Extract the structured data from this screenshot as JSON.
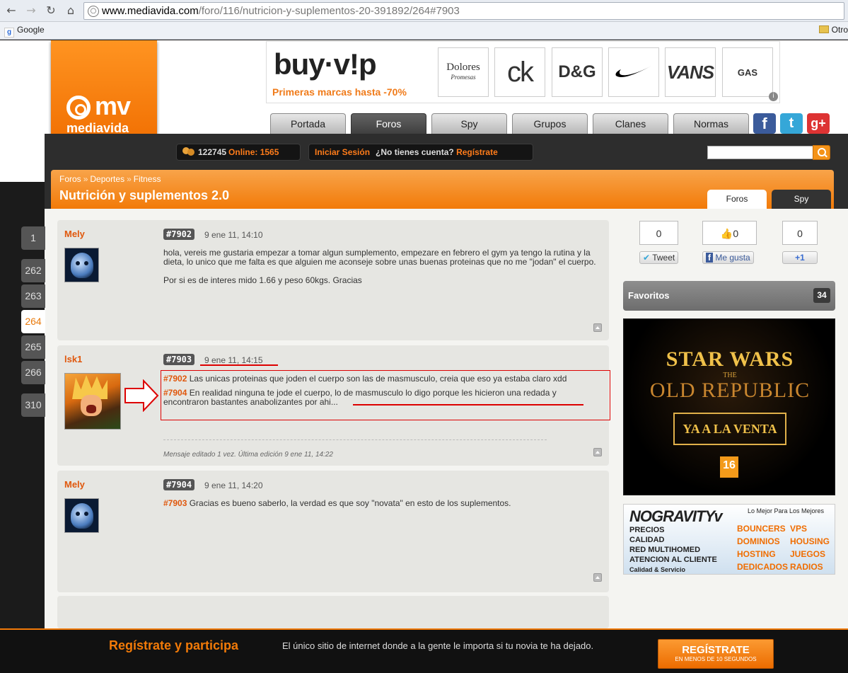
{
  "browser": {
    "url_host": "www.mediavida.com",
    "url_path": "/foro/116/nutricion-y-suplementos-20-391892/264#7903",
    "bookmarks": {
      "google": "Google",
      "other": "Otro"
    }
  },
  "logo": {
    "mv": "mv",
    "name": "mediavida"
  },
  "ad_top": {
    "brand": "buy·v!p",
    "tagline": "Primeras marcas hasta -70%",
    "brands": [
      "Dolores",
      "ck",
      "D&G",
      "Nike",
      "VANS",
      "GAS"
    ],
    "dolores_sub": "Promesas"
  },
  "nav": {
    "tabs": [
      "Portada",
      "Foros",
      "Spy",
      "Grupos",
      "Clanes",
      "Normas"
    ],
    "active": "Foros",
    "social": {
      "facebook": "f",
      "twitter": "t",
      "gplus": "g+"
    }
  },
  "userbar": {
    "users": "122745",
    "online_label": "Online: 1565",
    "login": "Iniciar Sesión",
    "no_account": "¿No tienes cuenta?",
    "register": "Regístrate"
  },
  "search": {
    "placeholder": ""
  },
  "header": {
    "breadcrumb": [
      "Foros",
      "Deportes",
      "Fitness"
    ],
    "title": "Nutrición y suplementos 2.0",
    "tab_foros": "Foros",
    "tab_spy": "Spy"
  },
  "pagination": [
    "1",
    "262",
    "263",
    "264",
    "265",
    "266",
    "310"
  ],
  "current_page": "264",
  "posts": [
    {
      "author": "Mely",
      "num": "#7902",
      "date": "9 ene 11, 14:10",
      "p1": "hola, vereis me gustaria empezar a tomar algun sumplemento, empezare en febrero el gym ya tengo la rutina y la dieta, lo unico que me falta es que alguien me aconseje sobre unas buenas proteinas que no me \"jodan\" el cuerpo.",
      "p2": "Por si es de interes mido 1.66 y peso 60kgs. Gracias"
    },
    {
      "author": "lsk1",
      "num": "#7903",
      "date": "9 ene 11, 14:15",
      "q1_ref": "#7902",
      "q1_text": "Las unicas proteinas que joden el cuerpo son las de masmusculo, creia que eso ya estaba claro xdd",
      "q2_ref": "#7904",
      "q2_text": "En realidad ninguna te jode el cuerpo, lo de masmusculo lo digo porque les hicieron una redada y encontraron bastantes anabolizantes por ahi...",
      "edit": "Mensaje editado 1 vez. Última edición 9 ene 11, 14:22"
    },
    {
      "author": "Mely",
      "num": "#7904",
      "date": "9 ene 11, 14:20",
      "q_ref": "#7903",
      "q_text": "Gracias es bueno saberlo, la verdad es que soy \"novata\" en esto de los suplementos."
    }
  ],
  "share": {
    "tweet_count": "0",
    "tweet_label": "Tweet",
    "like_count": "0",
    "like_label": "Me gusta",
    "plus_count": "0",
    "plus_label": "+1"
  },
  "favoritos": {
    "label": "Favoritos",
    "count": "34"
  },
  "ad_swtor": {
    "title": "STAR WARS",
    "the": "THE",
    "subtitle": "OLD REPUBLIC",
    "cta": "YA A LA VENTA",
    "rating": "16"
  },
  "ad_nogravity": {
    "logo": "NOGRAVITYv",
    "tagline": "Lo Mejor Para Los Mejores",
    "left": [
      "PRECIOS",
      "CALIDAD",
      "RED MULTIHOMED",
      "ATENCION AL CLIENTE"
    ],
    "small": "Calidad & Servicio",
    "col1": [
      "BOUNCERS",
      "DOMINIOS",
      "HOSTING",
      "DEDICADOS"
    ],
    "col2": [
      "VPS",
      "HOUSING",
      "JUEGOS",
      "RADIOS"
    ]
  },
  "footer": {
    "title": "Regístrate y participa",
    "text": "El único sitio de internet donde a la gente le importa si tu novia te ha dejado.",
    "btn": "REGÍSTRATE",
    "btn_sub": "EN MENOS DE 10 SEGUNDOS"
  }
}
